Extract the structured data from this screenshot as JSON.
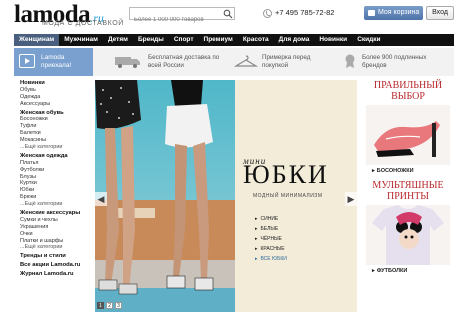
{
  "header": {
    "logo_main": "lamoda",
    "logo_ru": ".ru",
    "logo_tagline": "МОДА С ДОСТАВКОЙ",
    "search_placeholder": "Более 1 000 000 товаров",
    "phone": "+7 495 785-72-82",
    "cart_label": "Моя корзина",
    "login_label": "Вход"
  },
  "nav": {
    "items": [
      "Женщинам",
      "Мужчинам",
      "Детям",
      "Бренды",
      "Спорт",
      "Премиум",
      "Красота",
      "Для дома",
      "Новинки",
      "Скидки"
    ],
    "active_index": 0
  },
  "benefits": {
    "promo_line1": "Lamoda",
    "promo_line2": "приехала!",
    "delivery": "Бесплатная доставка по всей России",
    "fitting": "Примерка перед покупкой",
    "brands": "Более 900 подлинных брендов"
  },
  "sidebar": {
    "news_head": "Новинки",
    "news_items": [
      "Обувь",
      "Одежда",
      "Аксессуары"
    ],
    "shoes_head": "Женская обувь",
    "shoes_items": [
      "Босоножки",
      "Туфли",
      "Балетки",
      "Мокасины",
      "...Ещё категории"
    ],
    "clothes_head": "Женская одежда",
    "clothes_items": [
      "Платья",
      "Футболки",
      "Блузы",
      "Куртки",
      "Юбки",
      "Брюки",
      "...Ещё категории"
    ],
    "acc_head": "Женские аксессуары",
    "acc_items": [
      "Сумки и чехлы",
      "Украшения",
      "Очки",
      "Платки и шарфы",
      "...Ещё категории"
    ],
    "trends": "Тренды и стили",
    "all_actions": "Все акции Lamoda.ru",
    "journal": "Журнал Lamoda.ru"
  },
  "banner": {
    "mini": "мини",
    "title": "ЮБКИ",
    "subtitle": "МОДНЫЙ МИНИМАЛИЗМ",
    "links": [
      "СИНИЕ",
      "БЕЛЫЕ",
      "ЧЁРНЫЕ",
      "КРАСНЫЕ",
      "ВСЕ ЮБКИ"
    ],
    "pages": [
      "1",
      "2",
      "3"
    ],
    "active_page": 0
  },
  "right": {
    "title1_line1": "ПРАВИЛЬНЫЙ",
    "title1_line2": "ВЫБОР",
    "caption1": "БОСОНОЖКИ",
    "title2_line1": "МУЛЬТЯШНЫЕ",
    "title2_line2": "ПРИНТЫ",
    "caption2": "ФУТБОЛКИ"
  },
  "colors": {
    "nav_bg": "#111111",
    "nav_active": "#4a5f7e",
    "promo_bg": "#7aa0cf",
    "accent_red": "#b8292d",
    "logo_ru": "#2aa0d8"
  }
}
